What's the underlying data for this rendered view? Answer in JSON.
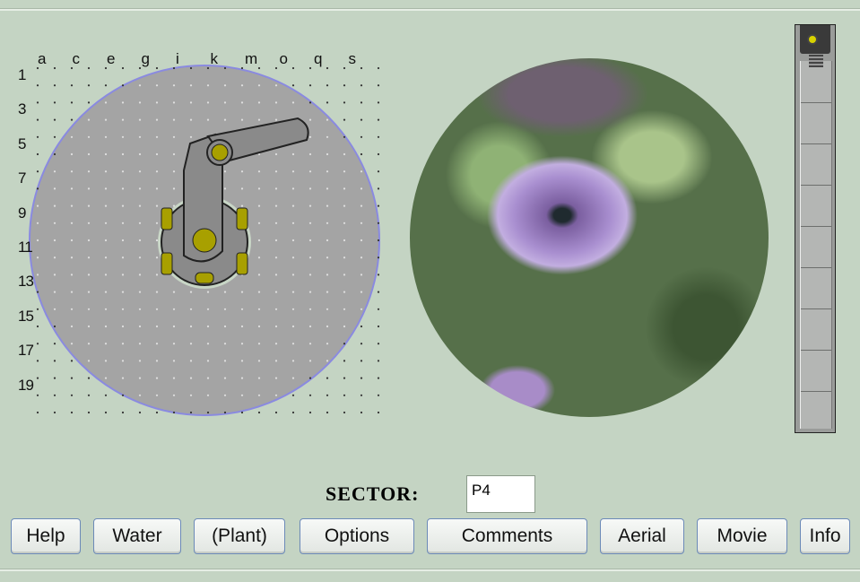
{
  "grid": {
    "columns": [
      "a",
      "c",
      "e",
      "g",
      "i",
      "k",
      "m",
      "o",
      "q",
      "s"
    ],
    "rows": [
      "1",
      "3",
      "5",
      "7",
      "9",
      "11",
      "13",
      "15",
      "17",
      "19"
    ]
  },
  "photo": {
    "subject": "purple petunia flower"
  },
  "slider": {
    "position": 0
  },
  "sector": {
    "label": "SECTOR:",
    "value": "P4"
  },
  "buttons": [
    "Help",
    "Water",
    "(Plant)",
    "Options",
    "Comments",
    "Aerial",
    "Movie",
    "Info"
  ],
  "colors": {
    "background": "#c4d4c3",
    "disk": "#a3a3a3",
    "knob": "#a8a000"
  }
}
